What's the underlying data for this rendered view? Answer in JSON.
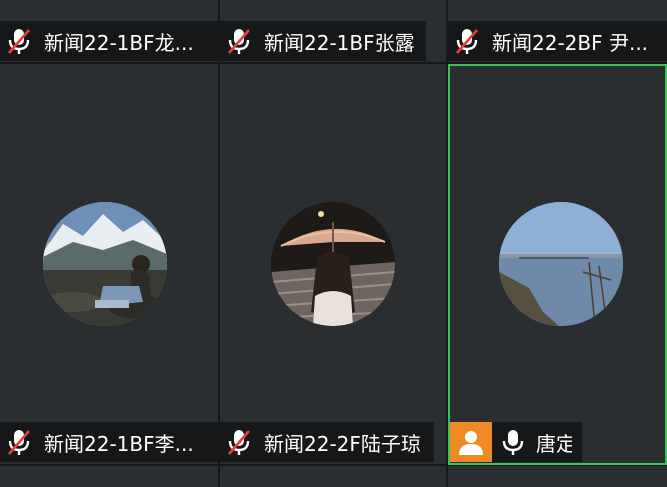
{
  "participants": [
    {
      "name": "新闻22-1BF龙...",
      "muted": true
    },
    {
      "name": "新闻22-1BF张露",
      "muted": true
    },
    {
      "name": "新闻22-2BF 尹...",
      "muted": true
    },
    {
      "name": "新闻22-1BF李...",
      "muted": true
    },
    {
      "name": "新闻22-2F陆子琼",
      "muted": true
    },
    {
      "name": "唐定",
      "muted": false,
      "host": true,
      "active": true
    }
  ],
  "colors": {
    "tile_bg": "#2b2e30",
    "active_border": "#3fbf58",
    "host_badge": "#f08a24",
    "muted_slash": "#e5413a"
  },
  "icons": {
    "muted": "mic-muted-icon",
    "unmuted": "mic-icon",
    "host": "host-person-icon"
  }
}
